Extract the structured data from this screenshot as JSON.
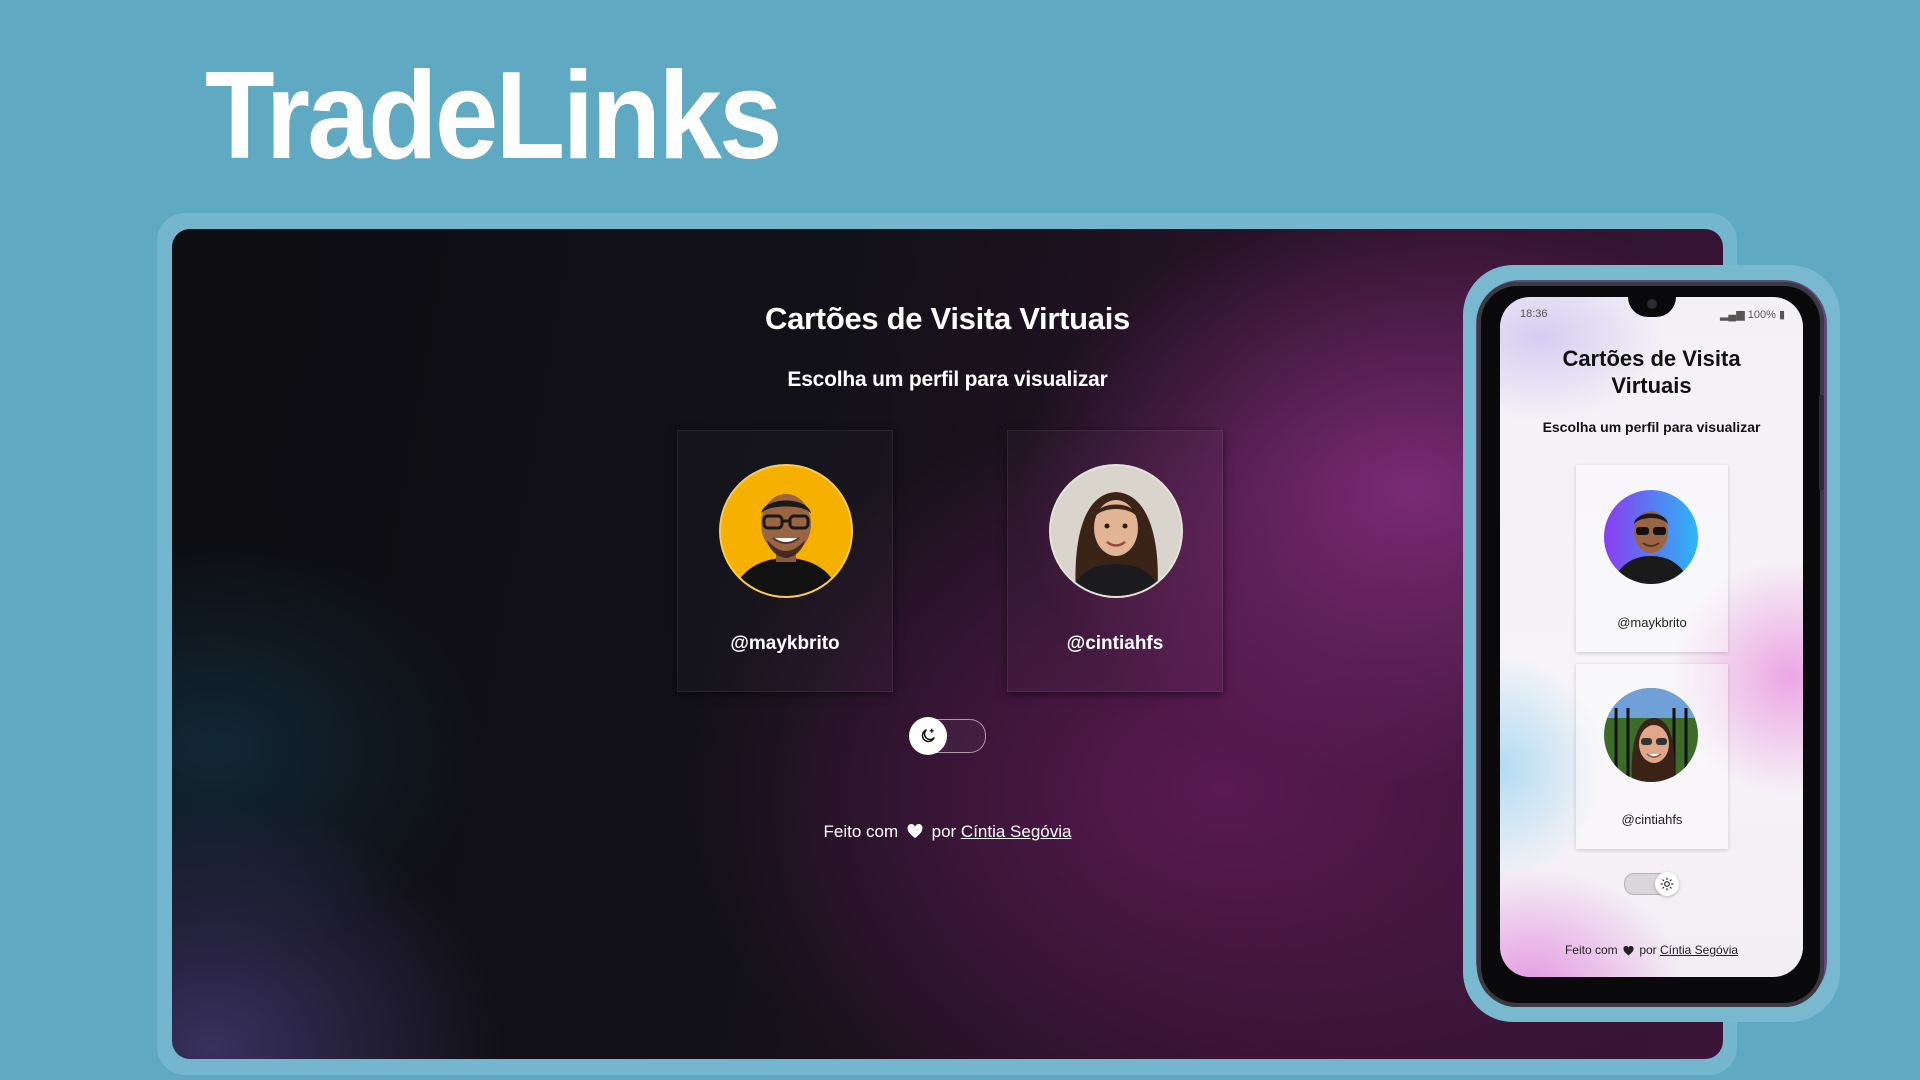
{
  "brand": {
    "title": "TradeLinks"
  },
  "desktop": {
    "heading": "Cartões de Visita Virtuais",
    "subtitle": "Escolha um perfil para visualizar",
    "profiles": [
      {
        "handle": "@maykbrito",
        "avatar_bg": "#f6b000"
      },
      {
        "handle": "@cintiahfs",
        "avatar_bg": "#d9d4cc"
      }
    ],
    "theme_toggle": {
      "state": "dark",
      "icon": "moon-icon"
    },
    "footer": {
      "prefix": "Feito com",
      "middle": "por",
      "author": "Cíntia Segóvia"
    }
  },
  "phone": {
    "status": {
      "time": "18:36",
      "battery": "100%"
    },
    "heading_line1": "Cartões de Visita",
    "heading_line2": "Virtuais",
    "subtitle": "Escolha um perfil para visualizar",
    "profiles": [
      {
        "handle": "@maykbrito"
      },
      {
        "handle": "@cintiahfs"
      }
    ],
    "theme_toggle": {
      "state": "light",
      "icon": "sun-icon"
    },
    "footer": {
      "prefix": "Feito com",
      "middle": "por",
      "author": "Cíntia Segóvia"
    }
  },
  "colors": {
    "page_background": "#5fa9c3",
    "dark_accent": "#872e80",
    "light_accent": "#e88cdc"
  }
}
